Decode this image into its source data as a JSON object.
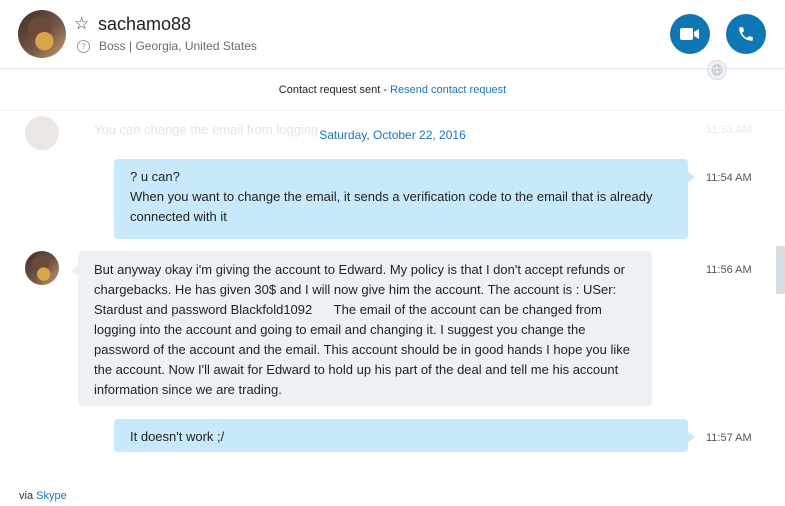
{
  "contact": {
    "name": "sachamo88",
    "subtitle": "Boss | Georgia, United States"
  },
  "header": {
    "video_call_icon": "video-camera-icon",
    "audio_call_icon": "phone-icon",
    "accent_color": "#0f78b4"
  },
  "notice": {
    "text": "Contact request sent - ",
    "link": "Resend contact request"
  },
  "faded_message": {
    "text": "You can change the email from logging ... ",
    "time": "11:53 AM"
  },
  "date_separator": "Saturday, October 22, 2016",
  "messages": [
    {
      "direction": "outgoing",
      "lines": [
        "? u can?",
        "When you want to change the email, it sends a verification code to the email that is already connected with it"
      ],
      "time": "11:54 AM"
    },
    {
      "direction": "incoming",
      "lines": [
        "But anyway okay i'm giving the account to Edward. My policy is that I don't accept refunds or chargebacks. He has given 30$ and I will now give him the account. The account is : USer: Stardust and password Blackfold1092      The email of the account can be changed from logging into the account and going to email and changing it. I suggest you change the password of the account and the email. This account should be in good hands I hope you like the account. Now I'll await for Edward to hold up his part of the deal and tell me his account information since we are trading."
      ],
      "time": "11:56 AM"
    },
    {
      "direction": "outgoing",
      "lines": [
        "It doesn't work ;/"
      ],
      "time": "11:57 AM"
    }
  ],
  "footer": {
    "prefix": "via ",
    "link": "Skype"
  }
}
